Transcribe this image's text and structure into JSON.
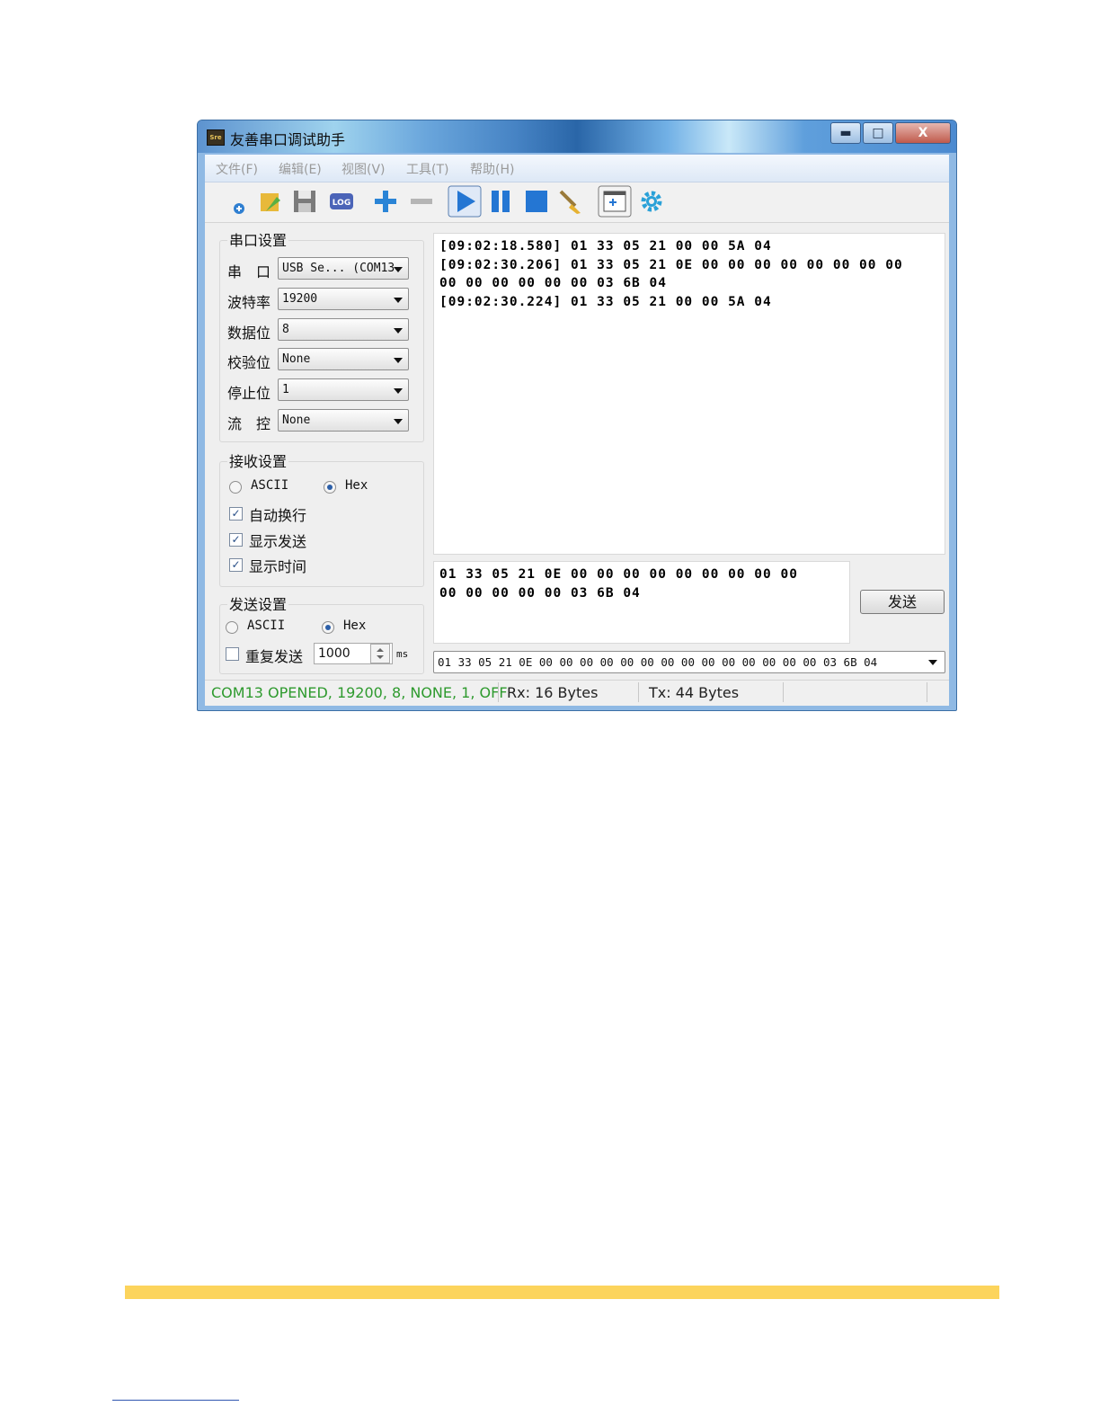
{
  "window": {
    "title": "友善串口调试助手",
    "app_icon_text": "Sre",
    "controls": {
      "minimize": "▬",
      "maximize": "□",
      "close": "X"
    }
  },
  "menu": [
    "文件(F)",
    "编辑(E)",
    "视图(V)",
    "工具(T)",
    "帮助(H)"
  ],
  "toolbar": {
    "icons": [
      "new-connection-icon",
      "open-folder-icon",
      "save-icon",
      "log-icon",
      "add-icon",
      "remove-icon",
      "start-icon",
      "pause-icon",
      "stop-icon",
      "clear-broom-icon",
      "new-window-icon",
      "settings-gear-icon"
    ],
    "log_label": "LOG"
  },
  "serial_settings": {
    "title": "串口设置",
    "fields": [
      {
        "label": "串　口",
        "value": "USB Se... (COM13"
      },
      {
        "label": "波特率",
        "value": "19200"
      },
      {
        "label": "数据位",
        "value": "8"
      },
      {
        "label": "校验位",
        "value": "None"
      },
      {
        "label": "停止位",
        "value": "1"
      },
      {
        "label": "流　控",
        "value": "None"
      }
    ]
  },
  "receive_settings": {
    "title": "接收设置",
    "mode_ascii": "ASCII",
    "mode_hex": "Hex",
    "selected_mode": "Hex",
    "options": [
      {
        "label": "自动换行",
        "checked": true
      },
      {
        "label": "显示发送",
        "checked": true
      },
      {
        "label": "显示时间",
        "checked": true
      }
    ]
  },
  "send_settings": {
    "title": "发送设置",
    "mode_ascii": "ASCII",
    "mode_hex": "Hex",
    "selected_mode": "Hex",
    "repeat_label": "重复发送",
    "repeat_checked": false,
    "interval": "1000",
    "interval_unit": "ms"
  },
  "receive_log": [
    "[09:02:18.580] 01 33 05 21 00 00 5A 04",
    "[09:02:30.206] 01 33 05 21 0E 00 00 00 00 00 00 00 00",
    "00 00 00 00 00 00 03 6B 04",
    "[09:02:30.224] 01 33 05 21 00 00 5A 04"
  ],
  "send_box": [
    "01 33 05 21 0E 00 00 00 00 00 00 00 00 00",
    "00 00 00 00 00 03 6B 04"
  ],
  "send_button": "发送",
  "history": "01 33 05 21 0E 00 00 00 00 00 00 00 00 00 00 00 00 00 00 03 6B 04",
  "status": {
    "port": "COM13 OPENED, 19200, 8, NONE, 1, OFF",
    "rx": "Rx: 16 Bytes",
    "tx": "Tx: 44 Bytes",
    "port_color": "#2e9a2e"
  }
}
